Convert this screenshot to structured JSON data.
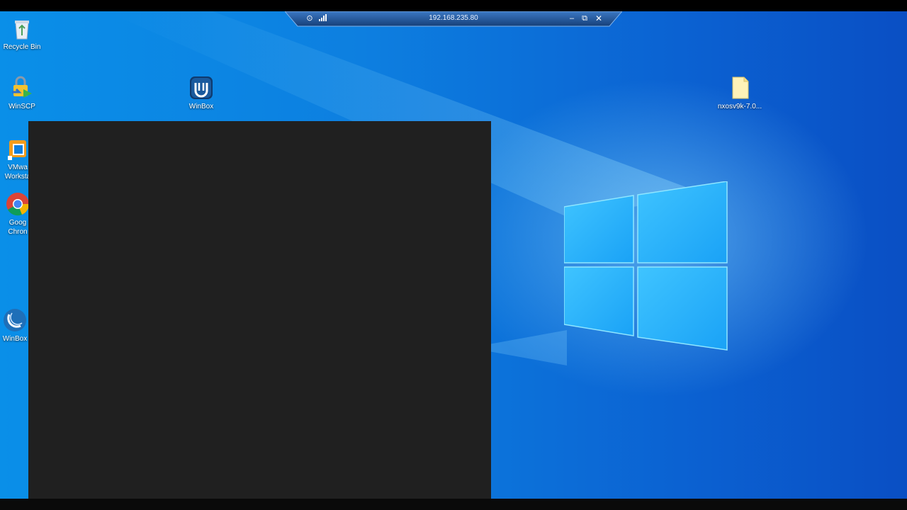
{
  "remote_session": {
    "address": "192.168.235.80"
  },
  "desktop": {
    "icons": [
      {
        "label": "Recycle Bin",
        "icon": "recycle-bin-icon"
      },
      {
        "label": "WinSCP",
        "icon": "winscp-icon"
      },
      {
        "label": "WinBox",
        "icon": "winbox-icon"
      },
      {
        "label": "nxosv9k-7.0...",
        "icon": "file-icon"
      },
      {
        "label": "VMwa",
        "label2": "Worksta",
        "icon": "vmware-icon"
      },
      {
        "label": "Goog",
        "label2": "Chron",
        "icon": "chrome-icon"
      },
      {
        "label": "WinBox",
        "icon": "winbox-blue-icon"
      }
    ]
  },
  "colors": {
    "desktop_blue": "#0a8fe8",
    "overlay_dark": "#202020",
    "rdp_bar": "#1f4f8c"
  }
}
